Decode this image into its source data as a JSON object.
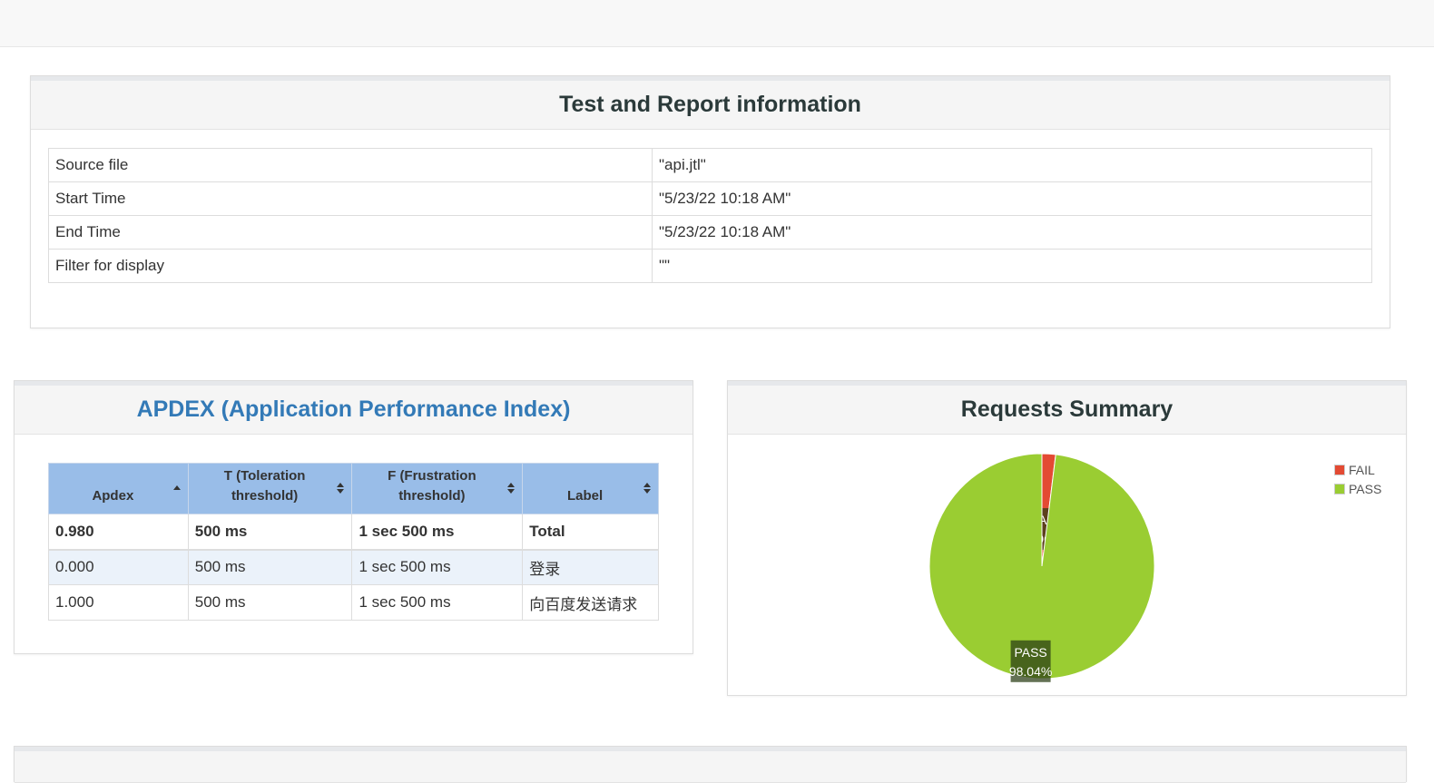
{
  "info": {
    "title": "Test and Report information",
    "rows": [
      {
        "key": "Source file",
        "value": "\"api.jtl\""
      },
      {
        "key": "Start Time",
        "value": "\"5/23/22 10:18 AM\""
      },
      {
        "key": "End Time",
        "value": "\"5/23/22 10:18 AM\""
      },
      {
        "key": "Filter for display",
        "value": "\"\""
      }
    ]
  },
  "apdex": {
    "title": "APDEX (Application Performance Index)",
    "headers": {
      "apdex": "Apdex",
      "t_line1": "T (Toleration",
      "t_line2": "threshold)",
      "f_line1": "F (Frustration",
      "f_line2": "threshold)",
      "label": "Label"
    },
    "rows": [
      {
        "apdex": "0.980",
        "t": "500 ms",
        "f": "1 sec 500 ms",
        "label": "Total"
      },
      {
        "apdex": "0.000",
        "t": "500 ms",
        "f": "1 sec 500 ms",
        "label": "登录"
      },
      {
        "apdex": "1.000",
        "t": "500 ms",
        "f": "1 sec 500 ms",
        "label": "向百度发送请求"
      }
    ]
  },
  "summary": {
    "title": "Requests Summary",
    "colors": {
      "fail": "#e34a33",
      "pass": "#9acd32"
    }
  },
  "chart_data": {
    "type": "pie",
    "title": "Requests Summary",
    "slices": [
      {
        "name": "FAIL",
        "value": 1.96,
        "label": "1.96%",
        "color": "#e34a33"
      },
      {
        "name": "PASS",
        "value": 98.04,
        "label": "98.04%",
        "color": "#9acd32"
      }
    ],
    "legend": "top-right"
  }
}
